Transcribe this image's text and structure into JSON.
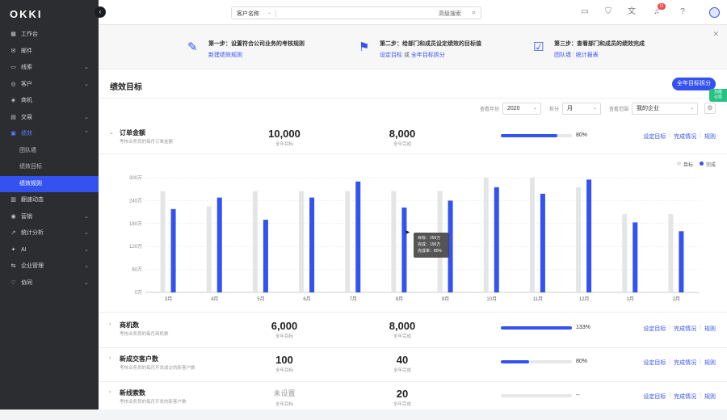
{
  "sidebar": {
    "logo": "OKKI",
    "items": [
      {
        "label": "工作台",
        "icon": "dashboard-icon",
        "glyph": "▦",
        "chev": ""
      },
      {
        "label": "邮件",
        "icon": "mail-icon",
        "glyph": "✉",
        "chev": ""
      },
      {
        "label": "线索",
        "icon": "leads-icon",
        "glyph": "▭",
        "chev": "⌄"
      },
      {
        "label": "客户",
        "icon": "customer-icon",
        "glyph": "◎",
        "chev": "⌄"
      },
      {
        "label": "商机",
        "icon": "opportunity-icon",
        "glyph": "◈",
        "chev": ""
      },
      {
        "label": "交易",
        "icon": "transaction-icon",
        "glyph": "▤",
        "chev": "⌄"
      },
      {
        "label": "绩效",
        "icon": "performance-icon",
        "glyph": "▣",
        "chev": "⌃",
        "active": true
      },
      {
        "label": "团队墙",
        "sub": true
      },
      {
        "label": "绩效目标",
        "sub": true
      },
      {
        "label": "绩效规则",
        "sub": true,
        "current": true
      },
      {
        "label": "翻速动态",
        "icon": "news-icon",
        "glyph": "▥",
        "chev": ""
      },
      {
        "label": "营销",
        "icon": "marketing-icon",
        "glyph": "◉",
        "chev": "⌄"
      },
      {
        "label": "统计分析",
        "icon": "analytics-icon",
        "glyph": "↗",
        "chev": "⌄"
      },
      {
        "label": "AI",
        "icon": "ai-icon",
        "glyph": "✦",
        "chev": "⌄"
      },
      {
        "label": "企业管理",
        "icon": "enterprise-icon",
        "glyph": "⇆",
        "chev": "⌄"
      },
      {
        "label": "协同",
        "icon": "collab-icon",
        "glyph": "♡",
        "chev": "⌄"
      }
    ]
  },
  "topbar": {
    "search_type": "客户名称",
    "advanced": "高级搜索",
    "notif_count": "11"
  },
  "banner": {
    "steps": [
      {
        "title": "第一步：设置符合公司业务的考核规则",
        "links": [
          "新建绩效规则"
        ],
        "or": ""
      },
      {
        "title": "第二步：给部门和成员设定绩效的目标值",
        "links": [
          "设定目标",
          "全年目标拆分"
        ],
        "or": "或"
      },
      {
        "title": "第三步：查看部门和成员的绩效完成",
        "links": [
          "团队墙",
          "统计报表"
        ],
        "or": ""
      }
    ]
  },
  "page": {
    "title": "绩效目标",
    "button": "全年目标拆分",
    "side_tag": [
      "功能",
      "引导"
    ]
  },
  "filters": [
    {
      "label": "查看年份",
      "value": "2020",
      "w": 48
    },
    {
      "label": "拆分",
      "value": "月",
      "w": 48
    },
    {
      "label": "查看范围",
      "value": "我的企业",
      "w": 82
    }
  ],
  "rows": [
    {
      "name": "订单金额",
      "desc": "考核业务员的每月订单金额",
      "target": "10,000",
      "target_label": "全年目标",
      "done": "8,000",
      "done_label": "全年完成",
      "pct": "80%",
      "fill": 0.8,
      "actions": [
        "设定目标",
        "完成情况",
        "规则"
      ]
    },
    {
      "name": "商机数",
      "desc": "考核业务员的每月商机数",
      "target": "6,000",
      "target_label": "全年目标",
      "done": "8,000",
      "done_label": "全年完成",
      "pct": "133%",
      "fill": 1.0,
      "actions": [
        "设定目标",
        "完成情况",
        "规则"
      ]
    },
    {
      "name": "新成交客户数",
      "desc": "考核业务员的每月开发成交的新客户数",
      "target": "100",
      "target_label": "全年目标",
      "done": "40",
      "done_label": "全年完成",
      "pct": "80%",
      "fill": 0.4,
      "actions": [
        "设定目标",
        "完成情况",
        "规则"
      ]
    },
    {
      "name": "新线索数",
      "desc": "考核业务员的每月开发的新客户数",
      "target": "未设置",
      "target_label": "全年目标",
      "done": "20",
      "done_label": "全年完成",
      "pct": "--",
      "fill": 0,
      "actions": [
        "设定目标",
        "完成情况",
        "规则"
      ]
    }
  ],
  "legend": {
    "target": "目标",
    "done": "完成"
  },
  "colors": {
    "accent": "#3452f0",
    "target_bar": "#e4e5e7",
    "done_bar": "#3452f0",
    "green": "#26c281"
  },
  "chart_data": {
    "type": "bar",
    "categories": [
      "3月",
      "4月",
      "5月",
      "6月",
      "7月",
      "8月",
      "9月",
      "10月",
      "11月",
      "12月",
      "1月",
      "2月"
    ],
    "ytick_labels": [
      "0万",
      "60万",
      "120万",
      "180万",
      "240万",
      "300万"
    ],
    "ylim": [
      0,
      300
    ],
    "series": [
      {
        "name": "目标",
        "values": [
          265,
          225,
          265,
          265,
          265,
          265,
          265,
          300,
          300,
          275,
          205,
          205
        ]
      },
      {
        "name": "完成",
        "values": [
          218,
          248,
          190,
          248,
          290,
          222,
          240,
          275,
          258,
          295,
          183,
          160
        ]
      }
    ],
    "tooltip": {
      "lines": [
        "目标：250万",
        "完成：190万",
        "完成率：80%"
      ]
    }
  }
}
